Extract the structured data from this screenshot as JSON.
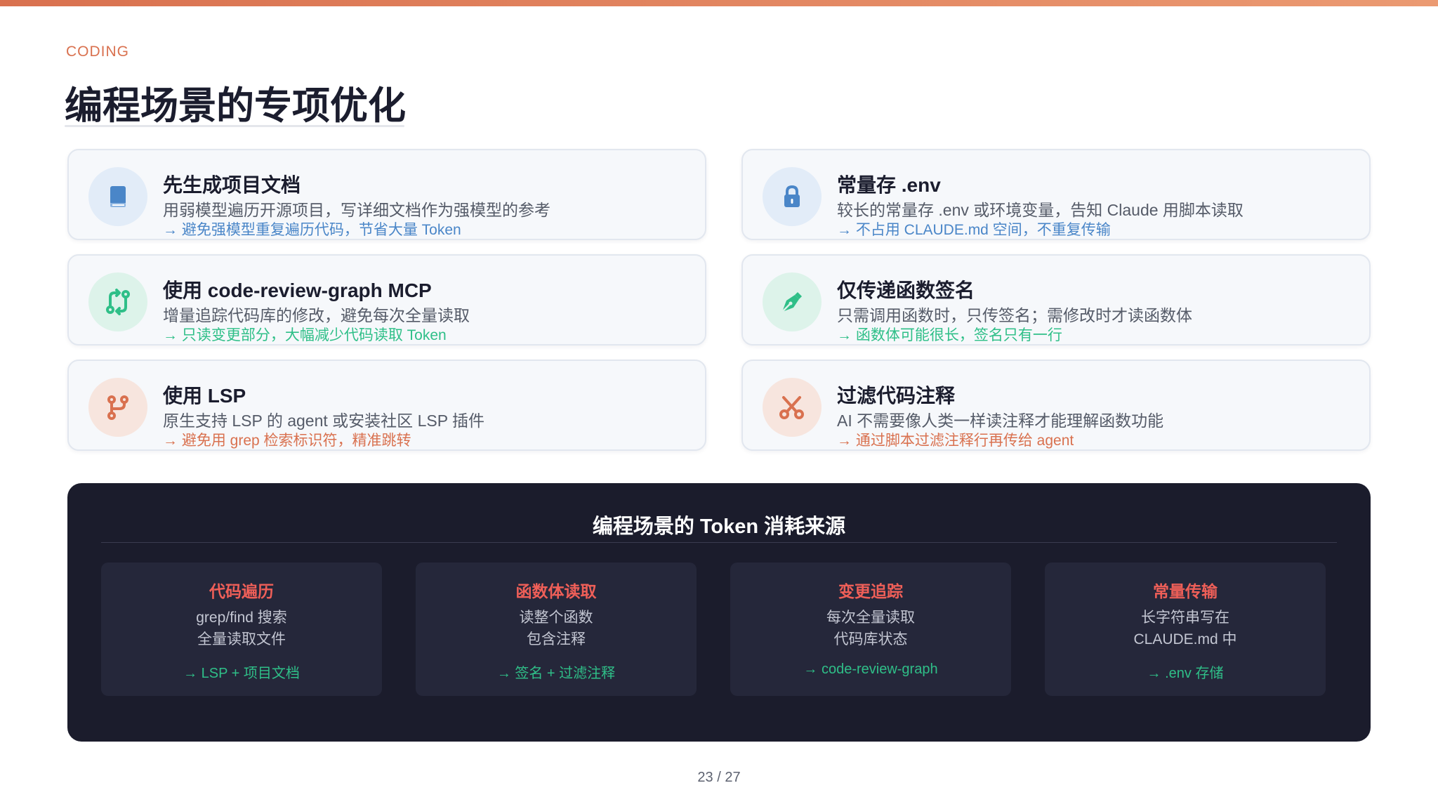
{
  "header": {
    "kicker": "CODING",
    "title": "编程场景的专项优化"
  },
  "tips": [
    {
      "icon": "book-icon",
      "title": "先生成项目文档",
      "desc": "用弱模型遍历开源项目，写详细文档作为强模型的参考",
      "note": "→ 避免强模型重复遍历代码，节省大量 Token",
      "accent": "#4a86c8",
      "icon_bg": "#e2ecf8"
    },
    {
      "icon": "git-compare-icon",
      "title": "使用 code-review-graph MCP",
      "desc": "增量追踪代码库的修改，避免每次全量读取",
      "note": "→ 只读变更部分，大幅减少代码读取 Token",
      "accent": "#2fbf88",
      "icon_bg": "#ddf3ea"
    },
    {
      "icon": "git-branch-icon",
      "title": "使用 LSP",
      "desc": "原生支持 LSP 的 agent 或安装社区 LSP 插件",
      "note": "→ 避免用 grep 检索标识符，精准跳转",
      "accent": "#d9714f",
      "icon_bg": "#f7e5de"
    },
    {
      "icon": "lock-icon",
      "title": "常量存 .env",
      "desc": "较长的常量存 .env 或环境变量，告知 Claude 用脚本读取",
      "note": "→ 不占用 CLAUDE.md 空间，不重复传输",
      "accent": "#4a86c8",
      "icon_bg": "#e2ecf8"
    },
    {
      "icon": "pen-nib-icon",
      "title": "仅传递函数签名",
      "desc": "只需调用函数时，只传签名；需修改时才读函数体",
      "note": "→ 函数体可能很长，签名只有一行",
      "accent": "#2fbf88",
      "icon_bg": "#ddf3ea"
    },
    {
      "icon": "scissors-icon",
      "title": "过滤代码注释",
      "desc": "AI 不需要像人类一样读注释才能理解函数功能",
      "note": "→ 通过脚本过滤注释行再传给 agent",
      "accent": "#d9714f",
      "icon_bg": "#f7e5de"
    }
  ],
  "sources": {
    "title": "编程场景的 Token 消耗来源",
    "items": [
      {
        "heading": "代码遍历",
        "line1": "grep/find 搜索",
        "line2": "全量读取文件",
        "fix": "→ LSP + 项目文档"
      },
      {
        "heading": "函数体读取",
        "line1": "读整个函数",
        "line2": "包含注释",
        "fix": "→ 签名 + 过滤注释"
      },
      {
        "heading": "变更追踪",
        "line1": "每次全量读取",
        "line2": "代码库状态",
        "fix": "→ code-review-graph"
      },
      {
        "heading": "常量传输",
        "line1": "长字符串写在",
        "line2": "CLAUDE.md 中",
        "fix": "→ .env 存储"
      }
    ]
  },
  "footer": {
    "page": "23 / 27"
  }
}
